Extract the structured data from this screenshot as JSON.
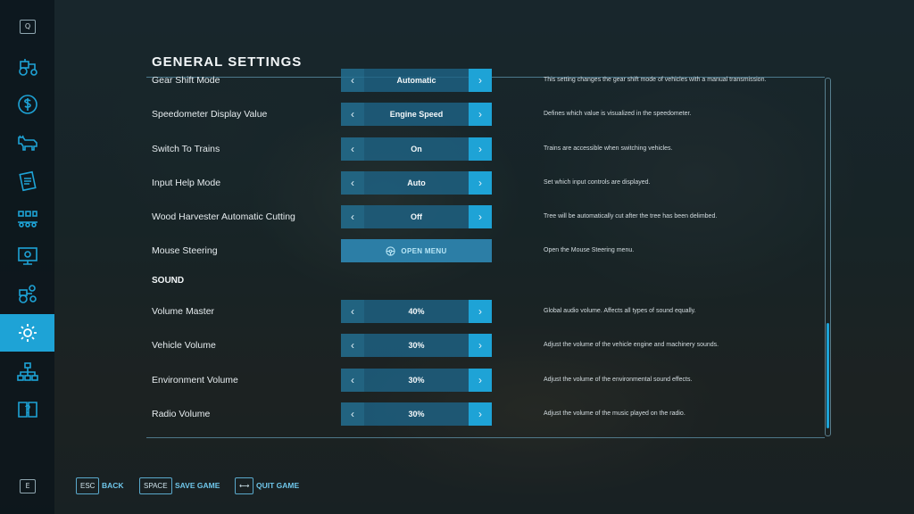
{
  "sidebar": {
    "top_key": "Q",
    "bottom_key": "E",
    "items": [
      {
        "icon": "tractor-icon"
      },
      {
        "icon": "dollar-icon"
      },
      {
        "icon": "cow-icon"
      },
      {
        "icon": "contracts-icon"
      },
      {
        "icon": "production-chain-icon"
      },
      {
        "icon": "statistics-screen-icon"
      },
      {
        "icon": "garage-icon"
      },
      {
        "icon": "gear-icon",
        "active": true
      },
      {
        "icon": "hierarchy-icon"
      },
      {
        "icon": "help-book-icon"
      }
    ]
  },
  "page": {
    "title": "GENERAL SETTINGS",
    "section_sound": "SOUND"
  },
  "settings": [
    {
      "label": "Gear Shift Mode",
      "value": "Automatic",
      "desc": "This setting changes the gear shift mode of vehicles with a manual transmission."
    },
    {
      "label": "Speedometer Display Value",
      "value": "Engine Speed",
      "desc": "Defines which value is visualized in the speedometer."
    },
    {
      "label": "Switch To Trains",
      "value": "On",
      "desc": "Trains are accessible when switching vehicles."
    },
    {
      "label": "Input Help Mode",
      "value": "Auto",
      "desc": "Set which input controls are displayed."
    },
    {
      "label": "Wood Harvester Automatic Cutting",
      "value": "Off",
      "desc": "Tree will be automatically cut after the tree has been delimbed."
    },
    {
      "label": "Mouse Steering",
      "button": "OPEN MENU",
      "desc": "Open the Mouse Steering menu."
    },
    {
      "label": "Volume Master",
      "value": "40%",
      "desc": "Global audio volume. Affects all types of sound equally."
    },
    {
      "label": "Vehicle Volume",
      "value": "30%",
      "desc": "Adjust the volume of the vehicle engine and machinery sounds."
    },
    {
      "label": "Environment Volume",
      "value": "30%",
      "desc": "Adjust the volume of the environmental sound effects."
    },
    {
      "label": "Radio Volume",
      "value": "30%",
      "desc": "Adjust the volume of the music played on the radio."
    }
  ],
  "bottom_bar": {
    "back_key": "ESC",
    "back_label": "BACK",
    "save_key": "SPACE",
    "save_label": "SAVE GAME",
    "quit_key": "⟷",
    "quit_label": "QUIT GAME"
  },
  "colors": {
    "accent": "#1ea3d6",
    "panel": "#1e6487"
  }
}
